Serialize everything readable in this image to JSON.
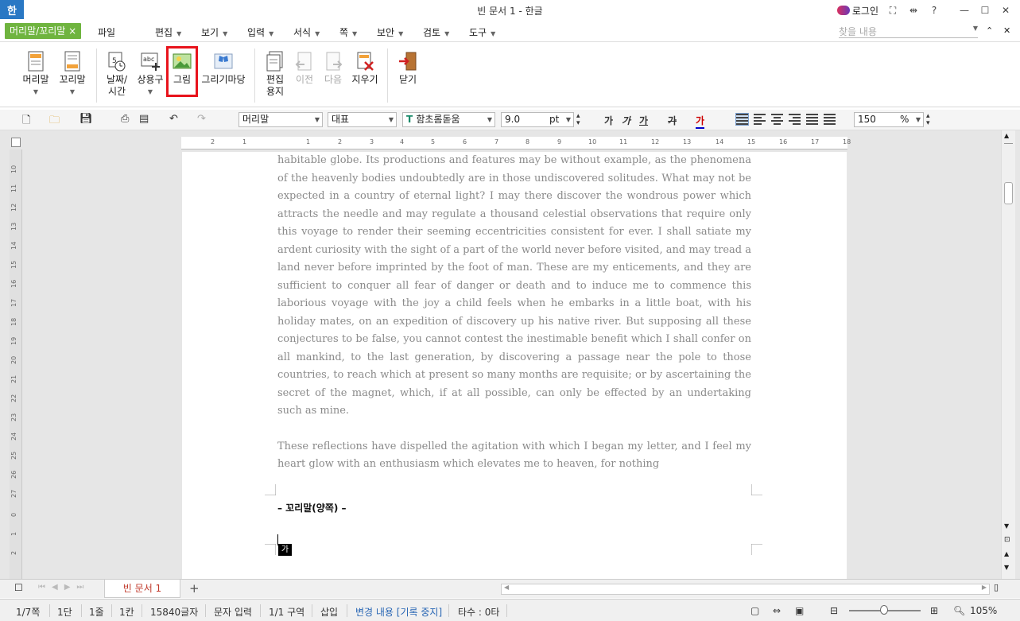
{
  "window": {
    "title": "빈 문서 1 - 한글",
    "logo": "한",
    "login": "로그인"
  },
  "menubar": {
    "context_tab": "머리말/꼬리말 ×",
    "file": "파일",
    "items": [
      "편집",
      "보기",
      "입력",
      "서식",
      "쪽",
      "보안",
      "검토",
      "도구"
    ],
    "search_placeholder": "찾을 내용"
  },
  "ribbon": {
    "header": "머리말",
    "footer": "꼬리말",
    "datetime_1": "날짜/",
    "datetime_2": "시간",
    "phrase": "상용구",
    "picture": "그림",
    "drawing": "그리기마당",
    "edit_paper_1": "편집",
    "edit_paper_2": "용지",
    "prev": "이전",
    "next": "다음",
    "erase": "지우기",
    "close": "닫기"
  },
  "format_toolbar": {
    "style": "머리말",
    "lang": "대표",
    "font": "함초롬돋움",
    "size": "9.0",
    "size_unit": "pt",
    "bold": "가",
    "italic": "가",
    "underline": "가",
    "strike": "가",
    "color": "가",
    "zoom": "150",
    "zoom_unit": "%"
  },
  "ruler": {
    "h_ticks": [
      "2",
      "1",
      "1",
      "2",
      "3",
      "4",
      "5",
      "6",
      "7",
      "8",
      "9",
      "10",
      "11",
      "12",
      "13",
      "14",
      "15",
      "16",
      "17",
      "18"
    ],
    "v_ticks": [
      "10",
      "11",
      "12",
      "13",
      "14",
      "15",
      "16",
      "17",
      "18",
      "19",
      "20",
      "21",
      "22",
      "23",
      "24",
      "25",
      "26",
      "27",
      "0",
      "1",
      "2"
    ]
  },
  "document": {
    "paragraph1": "habitable globe. Its productions and features may be without example, as the phenomena of the heavenly bodies undoubtedly are in those undiscovered solitudes. What may not be expected in a country of eternal light? I may there discover the wondrous power which attracts the needle and may regulate a thousand celestial observations that require only this voyage to render their seeming eccentricities consistent for ever. I shall satiate my ardent curiosity with the sight of a part of the world never before visited, and may tread a land never before imprinted by the foot of man. These are my enticements, and they are sufficient to conquer all fear of danger or death and to induce me to commence this laborious voyage with the joy a child feels when he embarks in a little boat, with his holiday mates, on an expedition of discovery up his native river. But supposing all these conjectures to be false, you cannot contest the inestimable benefit which I shall confer on all mankind, to the last generation, by discovering a passage near the pole to those countries, to reach which at present so many months are requisite; or by ascertaining the secret of the magnet, which, if at all possible, can only be effected by an undertaking such as mine.",
    "paragraph2": "These reflections have dispelled the agitation with which I began my letter, and I feel my heart glow with an enthusiasm which elevates me to heaven, for nothing",
    "footer_label": "– 꼬리말(양쪽) –",
    "ime_indicator": "가"
  },
  "tabs": {
    "doc_tab": "빈 문서 1",
    "add": "+"
  },
  "status": {
    "page": "1/7쪽",
    "column": "1단",
    "line": "1줄",
    "char": "1칸",
    "count": "15840글자",
    "mode": "문자 입력",
    "section": "1/1 구역",
    "insert": "삽입",
    "track": "변경 내용 [기록 중지]",
    "keystroke": "타수 : 0타",
    "zoom": "105%"
  },
  "colors": {
    "accent_green": "#6fb43f",
    "highlight_red": "#e8131c",
    "tab_red": "#c0392b",
    "link_blue": "#2a67b5"
  }
}
